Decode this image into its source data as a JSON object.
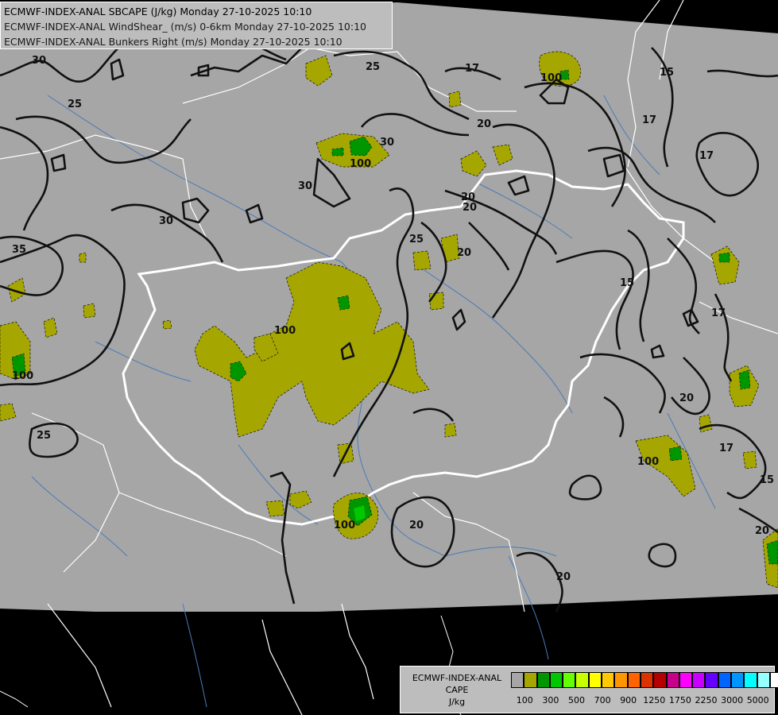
{
  "title_lines": [
    "ECMWF-INDEX-ANAL SBCAPE (J/kg) Monday 27-10-2025 10:10",
    "ECMWF-INDEX-ANAL WindShear_ (m/s) 0-6km Monday 27-10-2025 10:10",
    "ECMWF-INDEX-ANAL Bunkers Right (m/s) Monday 27-10-2025 10:10"
  ],
  "legend": {
    "title_line1": "ECMWF-INDEX-ANAL",
    "title_line2": "CAPE",
    "title_line3": "J/kg",
    "colors": [
      "#a6a6a6",
      "#a6a600",
      "#009600",
      "#00c800",
      "#64ff00",
      "#c8ff00",
      "#ffff00",
      "#ffc800",
      "#ff9600",
      "#ff6400",
      "#dc3200",
      "#b40000",
      "#c8008c",
      "#ff00ff",
      "#c800ff",
      "#6400ff",
      "#0064ff",
      "#0096ff",
      "#00ffff",
      "#96ffff",
      "#ffffff"
    ],
    "tick_labels": [
      "100",
      "300",
      "500",
      "700",
      "900",
      "1250",
      "1750",
      "2250",
      "3000",
      "5000"
    ]
  },
  "contour_labels": [
    "30",
    "25",
    "25",
    "17",
    "15",
    "17",
    "17",
    "20",
    "30",
    "100",
    "30",
    "25",
    "30",
    "20",
    "100",
    "35",
    "25",
    "100",
    "20",
    "15",
    "17",
    "20",
    "100",
    "15",
    "17",
    "20",
    "100",
    "20",
    "20",
    "100",
    "20"
  ],
  "colors": {
    "land": "#a6a6a6",
    "sea": "#000000",
    "cape_low": "#a6a600",
    "cape_mid": "#009600",
    "contour": "#111111",
    "border": "#ffffff",
    "river": "#4a7bb8"
  }
}
